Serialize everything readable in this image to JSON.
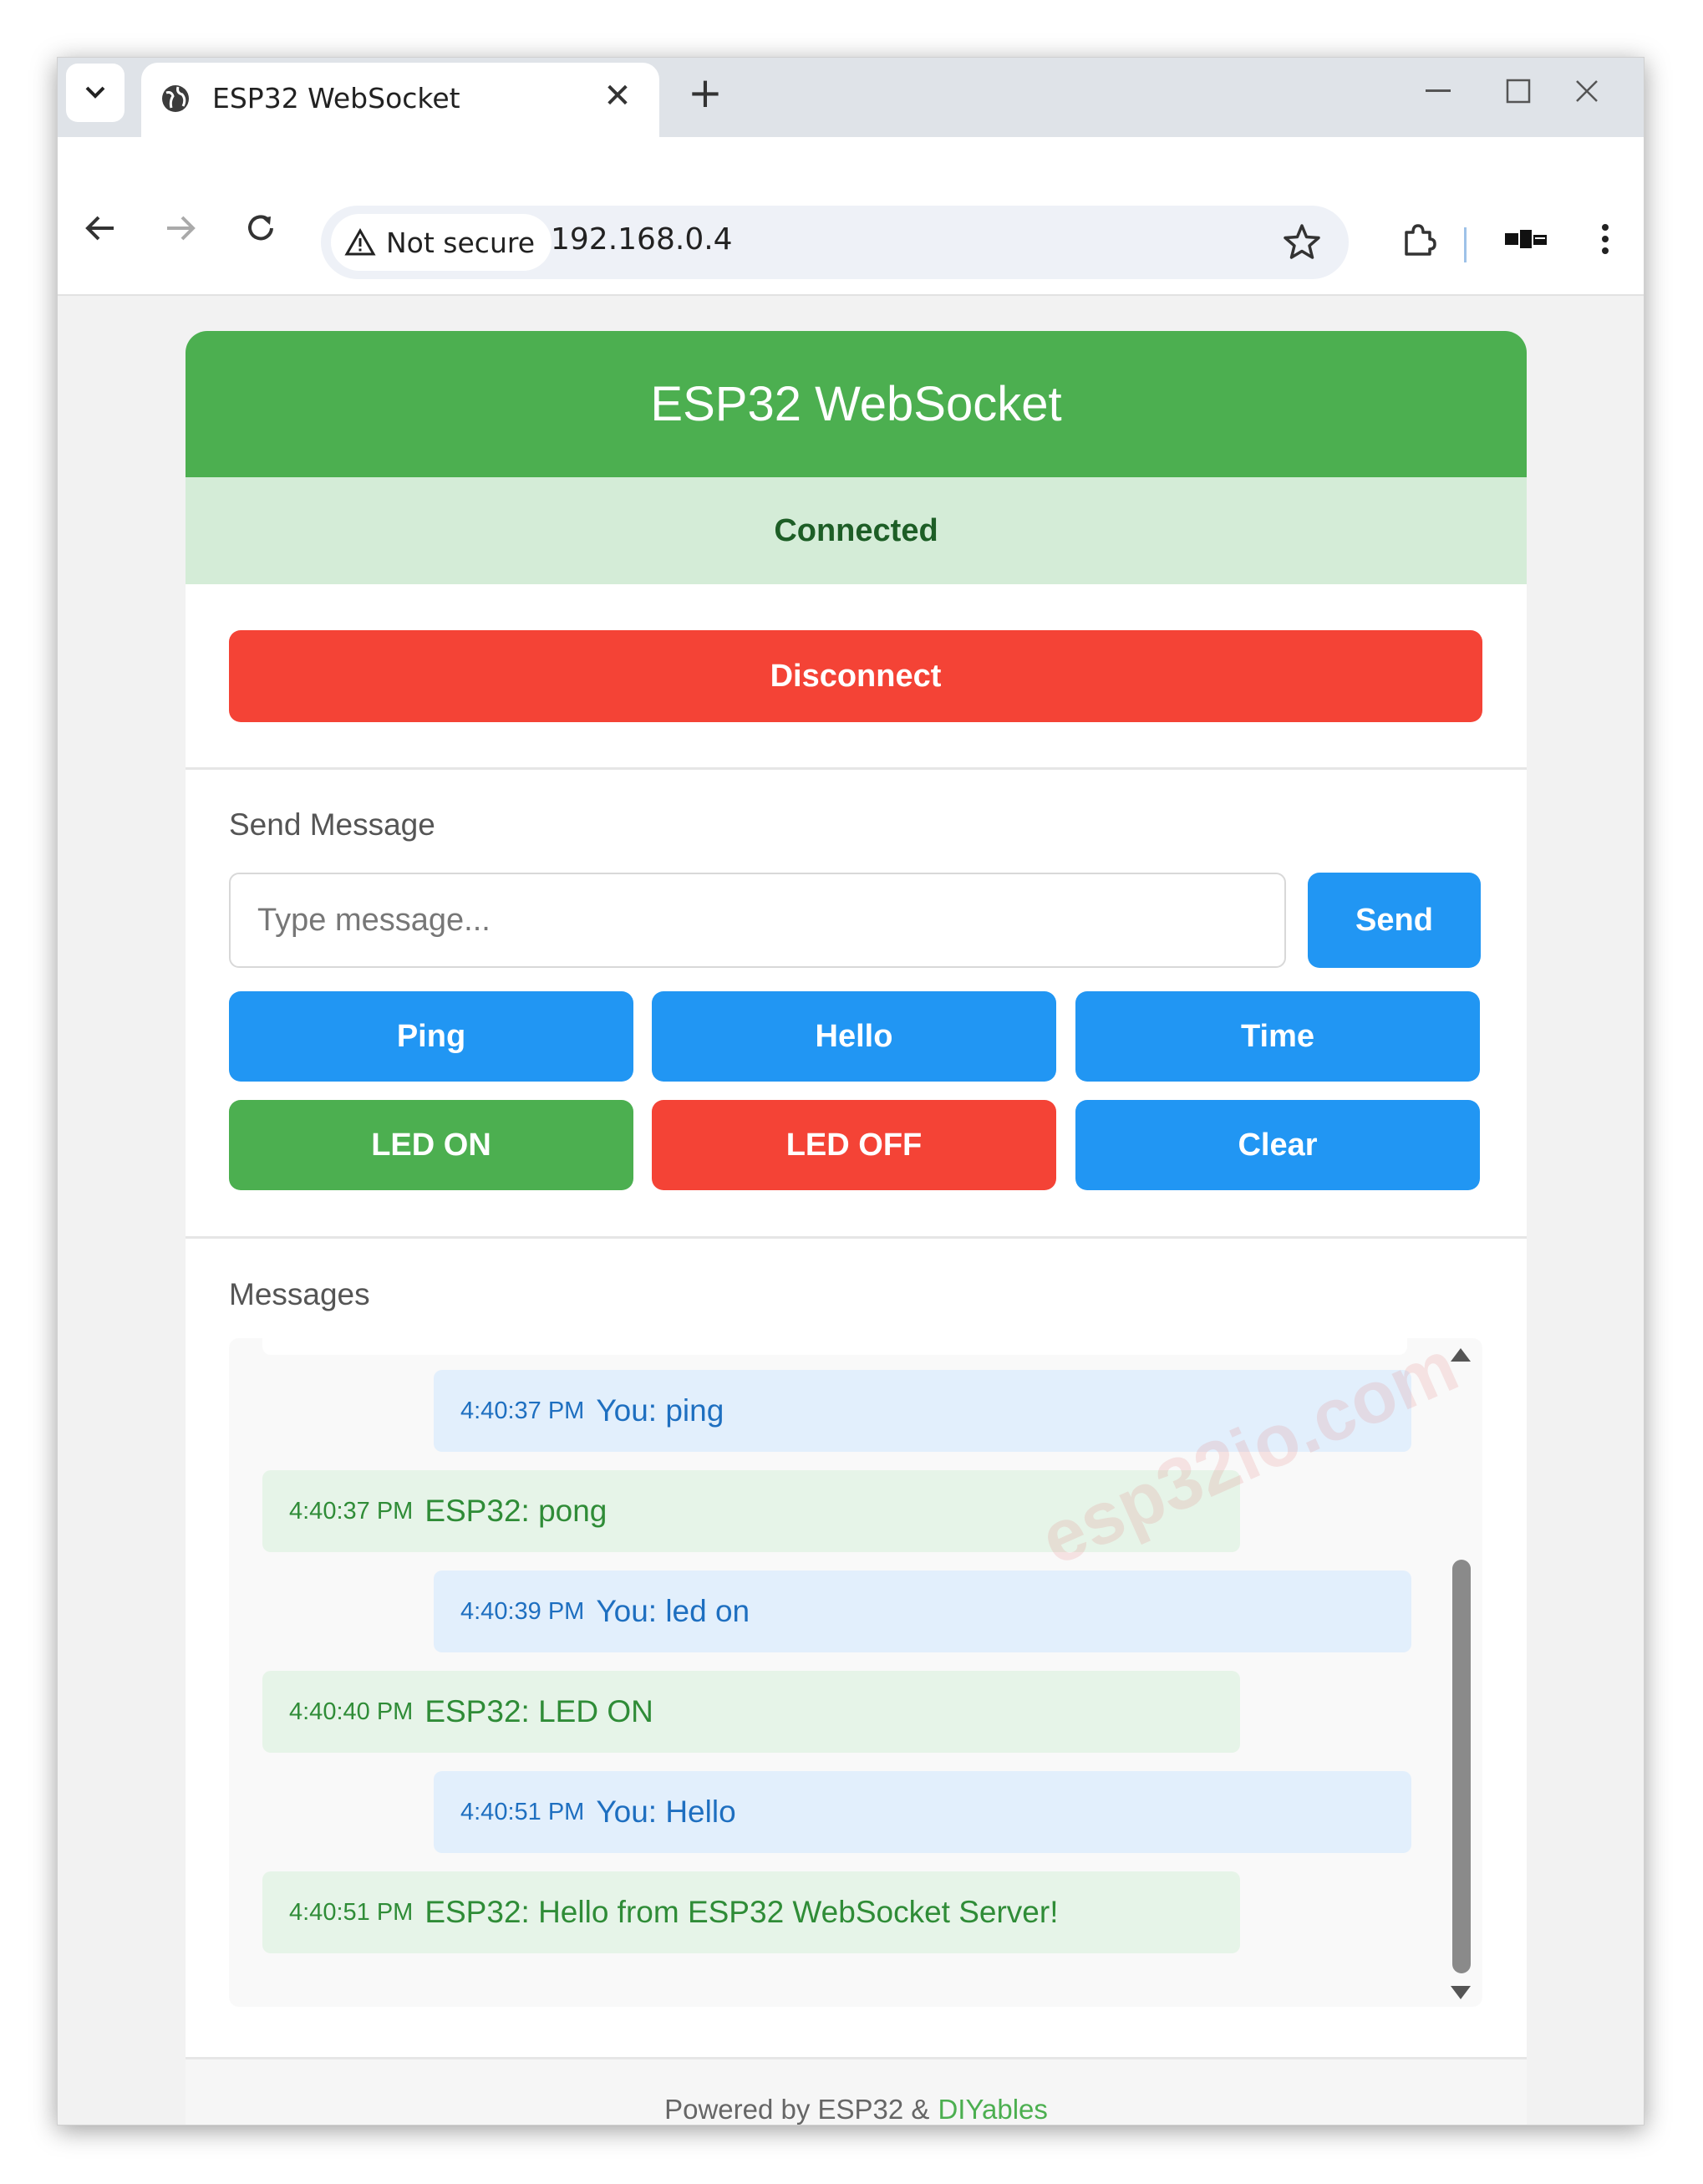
{
  "browser": {
    "tab_title": "ESP32 WebSocket",
    "security_label": "Not secure",
    "url": "192.168.0.4"
  },
  "page": {
    "title": "ESP32 WebSocket",
    "status": "Connected",
    "disconnect_label": "Disconnect",
    "send_section_label": "Send Message",
    "message_placeholder": "Type message...",
    "send_label": "Send",
    "quick_buttons": [
      "Ping",
      "Hello",
      "Time",
      "LED ON",
      "LED OFF",
      "Clear"
    ],
    "messages_label": "Messages",
    "messages": [
      {
        "sender": "you",
        "time": "4:40:37 PM",
        "text": "You: ping"
      },
      {
        "sender": "esp32",
        "time": "4:40:37 PM",
        "text": "ESP32: pong"
      },
      {
        "sender": "you",
        "time": "4:40:39 PM",
        "text": "You: led on"
      },
      {
        "sender": "esp32",
        "time": "4:40:40 PM",
        "text": "ESP32: LED ON"
      },
      {
        "sender": "you",
        "time": "4:40:51 PM",
        "text": "You: Hello"
      },
      {
        "sender": "esp32",
        "time": "4:40:51 PM",
        "text": "ESP32: Hello from ESP32 WebSocket Server!"
      }
    ],
    "watermark": "esp32io.com",
    "footer_prefix": "Powered by ESP32 &",
    "footer_brand": "DIYables"
  },
  "colors": {
    "header": "#4caf50",
    "status_bg": "#d4ecd7",
    "disconnect": "#f44336",
    "primary": "#2196f3",
    "led_on": "#4caf50",
    "led_off": "#f44336"
  },
  "icons": [
    "tab-search-icon",
    "globe-icon",
    "close-tab-icon",
    "new-tab-icon",
    "minimize-icon",
    "maximize-icon",
    "close-window-icon",
    "back-icon",
    "forward-icon",
    "reload-icon",
    "warning-icon",
    "bookmark-star-icon",
    "extensions-icon",
    "profile-icon",
    "menu-icon"
  ]
}
